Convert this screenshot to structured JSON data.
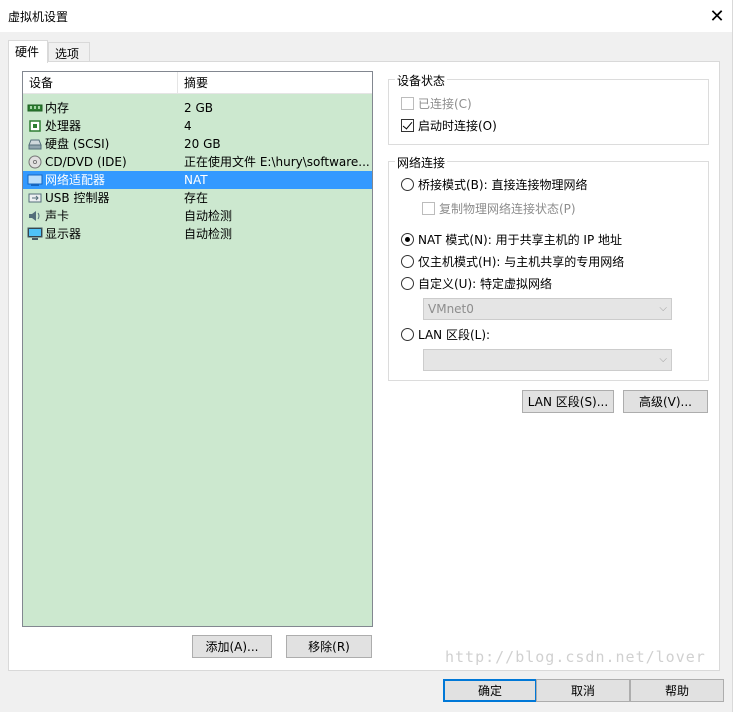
{
  "window": {
    "title": "虚拟机设置",
    "close_glyph": "✕"
  },
  "tabs": [
    {
      "label": "硬件",
      "active": true
    },
    {
      "label": "选项",
      "active": false
    }
  ],
  "device_list": {
    "headers": {
      "device": "设备",
      "summary": "摘要"
    },
    "rows": [
      {
        "name": "内存",
        "summary": "2 GB",
        "icon": "memory-icon",
        "selected": false
      },
      {
        "name": "处理器",
        "summary": "4",
        "icon": "processor-icon",
        "selected": false
      },
      {
        "name": "硬盘 (SCSI)",
        "summary": "20 GB",
        "icon": "hard-disk-icon",
        "selected": false
      },
      {
        "name": "CD/DVD (IDE)",
        "summary": "正在使用文件 E:\\hury\\software...",
        "icon": "cd-dvd-icon",
        "selected": false
      },
      {
        "name": "网络适配器",
        "summary": "NAT",
        "icon": "network-adapter-icon",
        "selected": true
      },
      {
        "name": "USB 控制器",
        "summary": "存在",
        "icon": "usb-icon",
        "selected": false
      },
      {
        "name": "声卡",
        "summary": "自动检测",
        "icon": "sound-card-icon",
        "selected": false
      },
      {
        "name": "显示器",
        "summary": "自动检测",
        "icon": "display-icon",
        "selected": false
      }
    ],
    "add_button": "添加(A)...",
    "remove_button": "移除(R)"
  },
  "device_status": {
    "title": "设备状态",
    "connected": {
      "label": "已连接(C)",
      "checked": false,
      "enabled": false
    },
    "connect_at_power_on": {
      "label": "启动时连接(O)",
      "checked": true,
      "enabled": true
    }
  },
  "network_connection": {
    "title": "网络连接",
    "bridged": {
      "label": "桥接模式(B): 直接连接物理网络",
      "selected": false
    },
    "replicate": {
      "label": "复制物理网络连接状态(P)",
      "checked": false,
      "enabled": false
    },
    "nat": {
      "label": "NAT 模式(N): 用于共享主机的 IP 地址",
      "selected": true
    },
    "host_only": {
      "label": "仅主机模式(H): 与主机共享的专用网络",
      "selected": false
    },
    "custom": {
      "label": "自定义(U): 特定虚拟网络",
      "selected": false
    },
    "custom_select_value": "VMnet0",
    "lan_segment": {
      "label": "LAN 区段(L):",
      "selected": false
    },
    "lan_select_value": ""
  },
  "action_buttons": {
    "lan_segments": "LAN 区段(S)...",
    "advanced": "高级(V)..."
  },
  "footer": {
    "ok": "确定",
    "cancel": "取消",
    "help": "帮助"
  },
  "watermark": "http://blog.csdn.net/lover"
}
